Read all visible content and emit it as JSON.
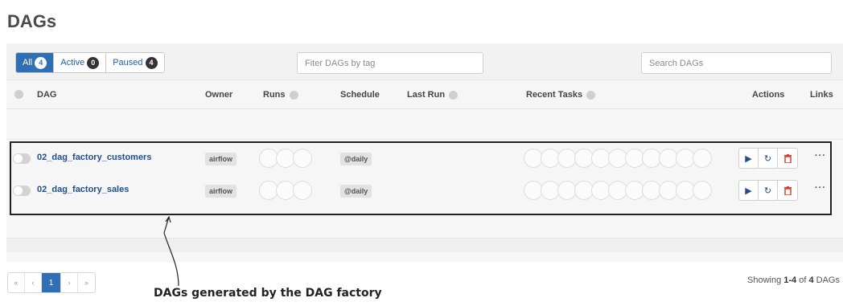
{
  "page": {
    "title": "DAGs"
  },
  "status_tabs": [
    {
      "label": "All",
      "count": "4",
      "active": true
    },
    {
      "label": "Active",
      "count": "0",
      "active": false
    },
    {
      "label": "Paused",
      "count": "4",
      "active": false
    }
  ],
  "filters": {
    "tag_placeholder": "Fiter DAGs by tag",
    "search_placeholder": "Search DAGs"
  },
  "table": {
    "columns": {
      "dag": "DAG",
      "owner": "Owner",
      "runs": "Runs",
      "schedule": "Schedule",
      "last_run": "Last Run",
      "recent_tasks": "Recent Tasks",
      "actions": "Actions",
      "links": "Links"
    },
    "rows": [
      {
        "name": "02_dag_factory_customers",
        "owner": "airflow",
        "schedule": "@daily"
      },
      {
        "name": "02_dag_factory_sales",
        "owner": "airflow",
        "schedule": "@daily"
      }
    ]
  },
  "actions": {
    "trigger_icon": "play-icon",
    "refresh_icon": "refresh-icon",
    "delete_icon": "trash-icon",
    "links_label": "···"
  },
  "pagination": {
    "first": "«",
    "prev": "‹",
    "current": "1",
    "next": "›",
    "last": "»"
  },
  "summary": {
    "prefix": "Showing ",
    "range": "1-4",
    "middle": " of ",
    "total": "4",
    "suffix": " DAGs"
  },
  "annotation": {
    "caption": "DAGs generated by the DAG factory"
  },
  "colors": {
    "accent": "#2f6fb5",
    "link": "#1f4e8a",
    "delete": "#e0412c"
  }
}
